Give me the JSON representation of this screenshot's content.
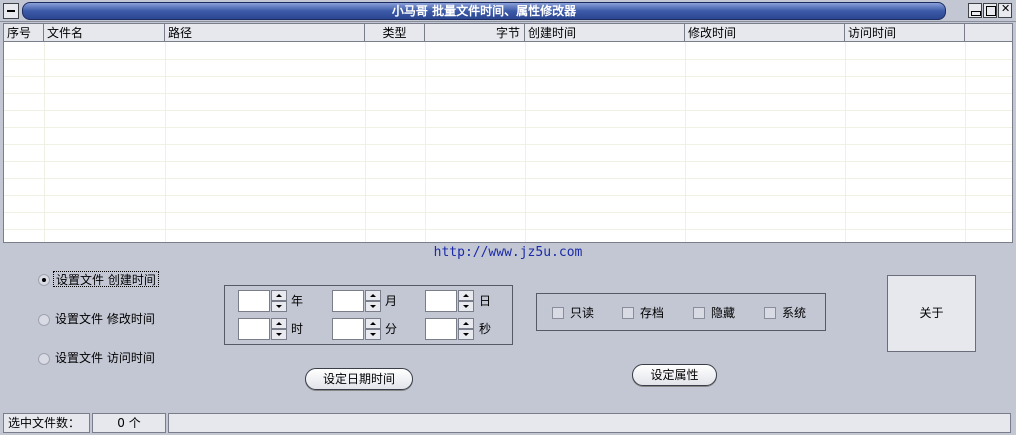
{
  "window": {
    "title": "小马哥    批量文件时间、属性修改器"
  },
  "list": {
    "columns": [
      "序号",
      "文件名",
      "路径",
      "类型",
      "字节",
      "创建时间",
      "修改时间",
      "访问时间"
    ]
  },
  "website": "http://www.jz5u.com",
  "time_options": [
    {
      "label": "设置文件   创建时间",
      "selected": true
    },
    {
      "label": "设置文件   修改时间",
      "selected": false
    },
    {
      "label": "设置文件   访问时间",
      "selected": false
    }
  ],
  "date_units": [
    "年",
    "月",
    "日",
    "时",
    "分",
    "秒"
  ],
  "attributes": [
    "只读",
    "存档",
    "隐藏",
    "系统"
  ],
  "buttons": {
    "set_datetime": "设定日期时间",
    "set_attributes": "设定属性",
    "about": "关于"
  },
  "status": {
    "selected_label": "选中文件数：",
    "selected_count": "0 个",
    "message": ""
  }
}
